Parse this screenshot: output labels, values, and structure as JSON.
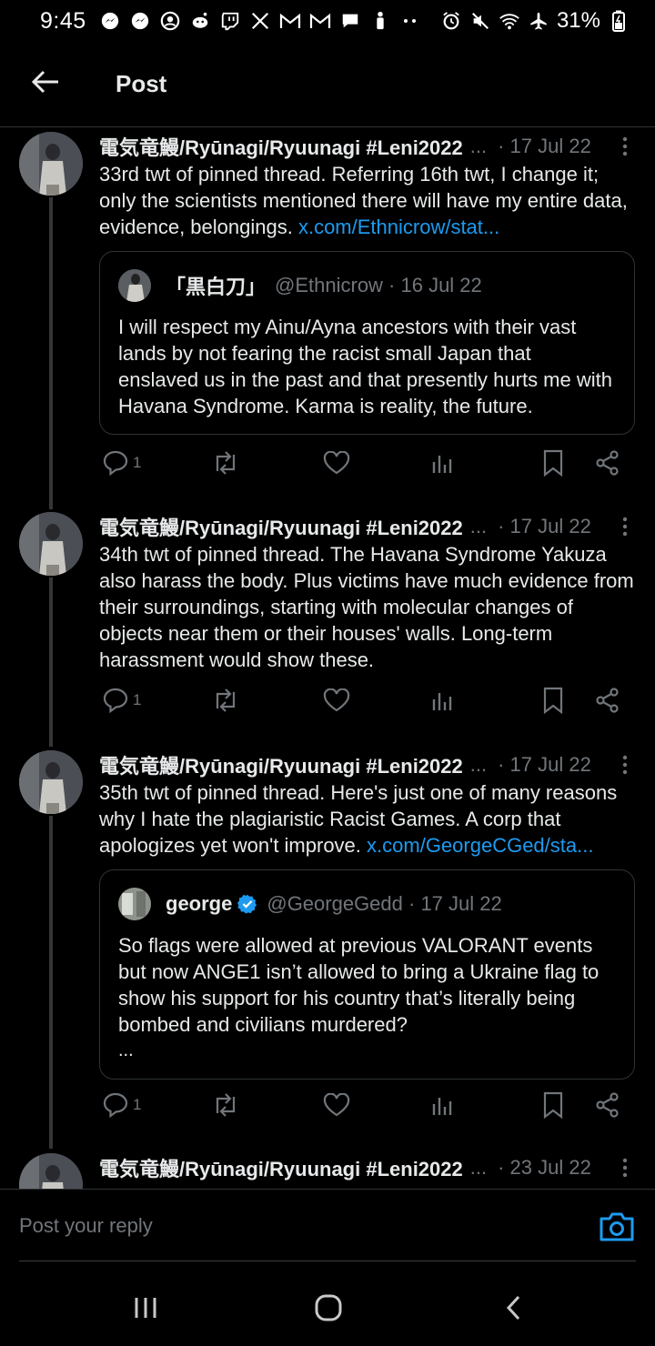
{
  "status_bar": {
    "time": "9:45",
    "battery": "31%",
    "icons": [
      "messenger-icon",
      "messenger-icon",
      "account-icon",
      "reddit-icon",
      "twitch-icon",
      "x-icon",
      "gmail-icon",
      "gmail-icon",
      "chat-icon",
      "figure-icon",
      "more-dots-icon"
    ],
    "right_icons": [
      "alarm-icon",
      "mute-icon",
      "wifi-icon",
      "airplane-icon",
      "battery-charging-icon"
    ]
  },
  "header": {
    "title": "Post",
    "back_icon": "arrow-left-icon"
  },
  "posts": [
    {
      "author": "電気竜鰻/Ryūnagi/Ryuunagi #Leni2022",
      "ellipsis": "...",
      "date": "· 17 Jul 22",
      "text": "33rd twt of pinned thread. Referring 16th twt, I change it; only the scientists mentioned there will have my entire data, evidence, belongings.",
      "link": "x.com/Ethnicrow/stat...",
      "quote": {
        "name": "「黒白刀」",
        "handle": "@Ethnicrow · 16 Jul 22",
        "text": "I will respect my Ainu/Ayna ancestors with their vast lands by not fearing the racist small Japan that enslaved us in the past and that presently hurts me with Havana Syndrome. Karma is reality, the future."
      },
      "reply_count": "1"
    },
    {
      "author": "電気竜鰻/Ryūnagi/Ryuunagi #Leni2022",
      "ellipsis": "...",
      "date": "· 17 Jul 22",
      "text": "34th twt of pinned thread. The Havana Syndrome Yakuza also harass the body. Plus victims have much evidence from their surroundings, starting with molecular changes of objects near them or their houses' walls. Long-term harassment would show these.",
      "reply_count": "1"
    },
    {
      "author": "電気竜鰻/Ryūnagi/Ryuunagi #Leni2022",
      "ellipsis": "...",
      "date": "· 17 Jul 22",
      "text": "35th twt of pinned thread. Here's just one of many reasons why I hate the plagiaristic Racist Games. A corp that apologizes yet won't improve.",
      "link": "x.com/GeorgeCGed/sta...",
      "quote": {
        "name": "george",
        "handle": "@GeorgeGedd · 17 Jul 22",
        "text": "So flags were allowed at previous VALORANT events but now ANGE1 isn’t allowed to bring a Ukraine flag to show his support for his country that’s literally being bombed and civilians murdered?",
        "more": "..."
      },
      "reply_count": "1"
    },
    {
      "author": "電気竜鰻/Ryūnagi/Ryuunagi #Leni2022",
      "ellipsis": "...",
      "date": "· 23 Jul 22"
    }
  ],
  "reply_bar": {
    "placeholder": "Post your reply",
    "camera_icon": "camera-icon"
  },
  "colors": {
    "background": "#000000",
    "text": "#e7e9ea",
    "muted": "#71767b",
    "link": "#1d9bf0",
    "border": "#2f3336",
    "verified": "#1d9bf0"
  }
}
